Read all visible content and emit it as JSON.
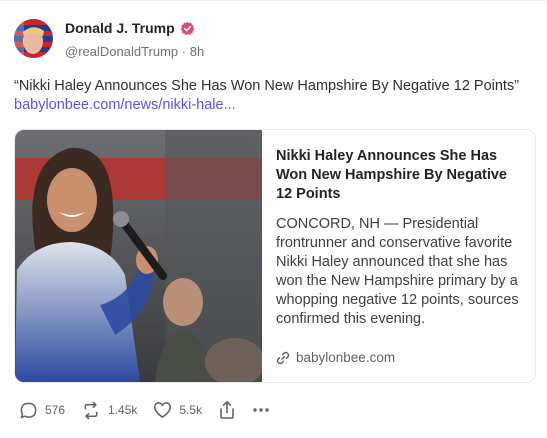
{
  "author": {
    "name": "Donald J. Trump",
    "handle": "@realDonaldTrump",
    "separator": "·",
    "time": "8h",
    "verified_color": "#e0457b"
  },
  "post": {
    "text": "“Nikki Haley Announces She Has Won New Hampshire By Negative 12 Points”",
    "link": "babylonbee.com/news/nikki-hale..."
  },
  "card": {
    "title": "Nikki Haley Announces She Has Won New Hampshire By Negative 12 Points",
    "description": "CONCORD, NH — Presidential frontrunner and conservative favorite Nikki Haley announced that she has won the New Hampshire primary by a whopping negative 12 points, sources confirmed this evening.",
    "domain": "babylonbee.com"
  },
  "actions": {
    "replies": "576",
    "reposts": "1.45k",
    "likes": "5.5k"
  },
  "colors": {
    "link": "#5a55d8",
    "muted": "#6b7178"
  }
}
